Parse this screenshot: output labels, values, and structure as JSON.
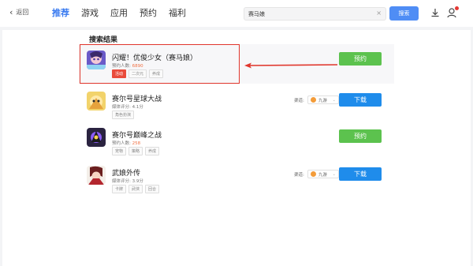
{
  "topbar": {
    "back_label": "返回",
    "nav": [
      {
        "label": "推荐",
        "active": true
      },
      {
        "label": "游戏",
        "active": false
      },
      {
        "label": "应用",
        "active": false
      },
      {
        "label": "预约",
        "active": false
      },
      {
        "label": "福利",
        "active": false
      }
    ],
    "search": {
      "value": "赛马娘",
      "clear_icon": "close-icon",
      "button_label": "搜索"
    },
    "icons": [
      "download-icon",
      "user-icon"
    ]
  },
  "results": {
    "title": "搜索结果",
    "items": [
      {
        "name": "闪耀！优俊少女（赛马娘）",
        "meta_label": "预约人数:",
        "meta_value": "6890",
        "tags": [
          "活动",
          "二次元",
          "养成"
        ],
        "button": "预约",
        "button_color": "#5cc24e",
        "icon": "game-icon-uma-musume"
      },
      {
        "name": "赛尔号星球大战",
        "meta_label": "媒体评分:",
        "meta_value": "4.1分",
        "tags": [
          "角色扮演"
        ],
        "channel_label": "渠道:",
        "channel_name": "九游",
        "button": "下载",
        "button_color": "#1f8ceb",
        "icon": "game-icon-seer-star-wars"
      },
      {
        "name": "赛尔号巅峰之战",
        "meta_label": "预约人数:",
        "meta_value": "258",
        "tags": [
          "宠物",
          "策略",
          "养成"
        ],
        "button": "预约",
        "button_color": "#5cc24e",
        "icon": "game-icon-seer-peak-battle"
      },
      {
        "name": "武娘外传",
        "meta_label": "媒体评分:",
        "meta_value": "3.9分",
        "tags": [
          "卡牌",
          "武侠",
          "回合"
        ],
        "channel_label": "渠道:",
        "channel_name": "九游",
        "button": "下载",
        "button_color": "#1f8ceb",
        "icon": "game-icon-wuniang"
      }
    ]
  },
  "annotation": {
    "highlight_color": "#e0362c"
  }
}
